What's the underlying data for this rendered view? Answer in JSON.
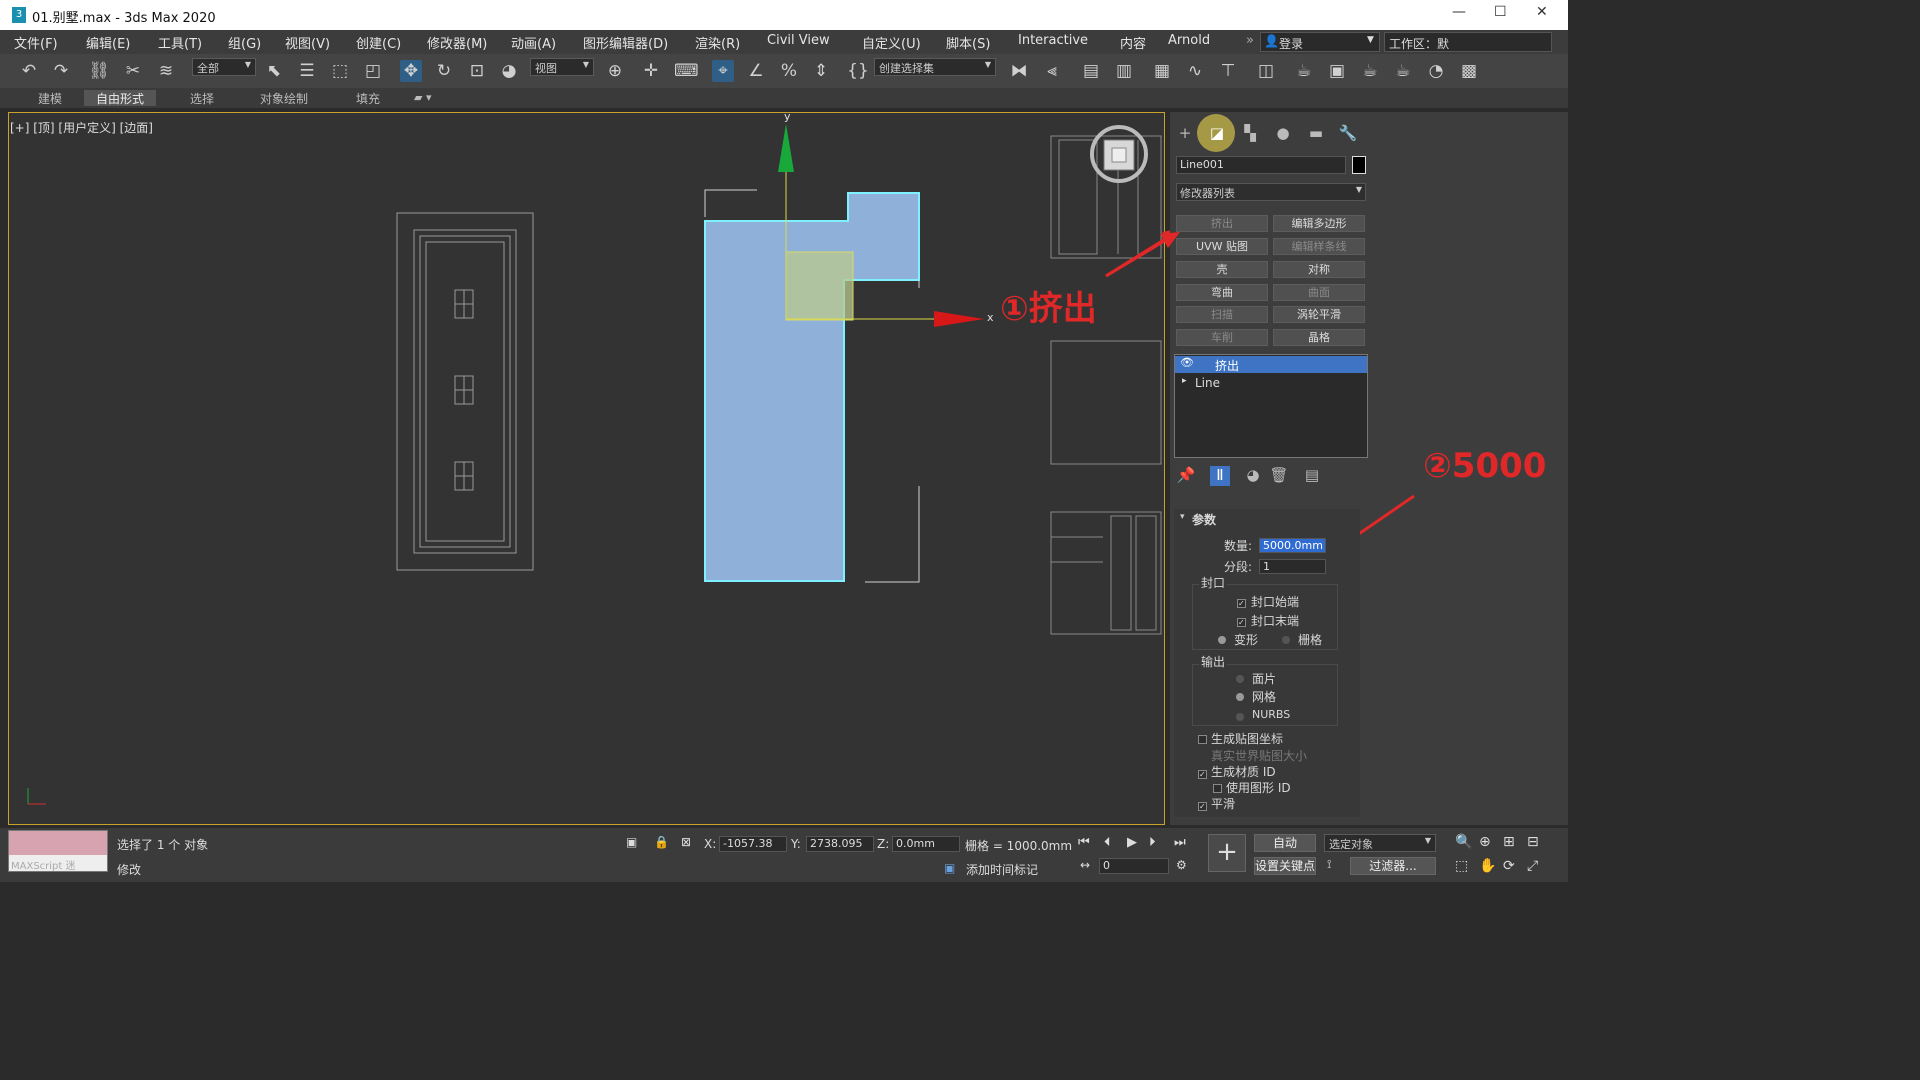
{
  "window": {
    "title": "01.别墅.max - 3ds Max 2020",
    "app_icon": "3"
  },
  "menu": [
    "文件(F)",
    "编辑(E)",
    "工具(T)",
    "组(G)",
    "视图(V)",
    "创建(C)",
    "修改器(M)",
    "动画(A)",
    "图形编辑器(D)",
    "渲染(R)",
    "Civil View",
    "自定义(U)",
    "脚本(S)",
    "Interactive",
    "内容",
    "Arnold"
  ],
  "login": "登录",
  "workspace_partial": "工作区：默",
  "toolbar": {
    "filter_select": "全部",
    "ref_coord": "视图",
    "named_selection": "创建选择集"
  },
  "ribbon_tabs": [
    "建模",
    "自由形式",
    "选择",
    "对象绘制",
    "填充"
  ],
  "ribbon_active": "自由形式",
  "viewport": {
    "label": "[+] [顶] [用户定义] [边面]",
    "axis_x": "x",
    "axis_y": "y",
    "annotation_1": "①挤出"
  },
  "command_panel": {
    "object_name": "Line001",
    "modifier_list": "修改器列表",
    "modifier_buttons": [
      {
        "label": "挤出",
        "enabled": false
      },
      {
        "label": "编辑多边形",
        "enabled": true
      },
      {
        "label": "UVW 贴图",
        "enabled": true
      },
      {
        "label": "编辑样条线",
        "enabled": false
      },
      {
        "label": "壳",
        "enabled": true
      },
      {
        "label": "对称",
        "enabled": true
      },
      {
        "label": "弯曲",
        "enabled": true
      },
      {
        "label": "曲面",
        "enabled": false
      },
      {
        "label": "扫描",
        "enabled": false
      },
      {
        "label": "涡轮平滑",
        "enabled": true
      },
      {
        "label": "车削",
        "enabled": false
      },
      {
        "label": "晶格",
        "enabled": true
      }
    ],
    "stack": [
      "挤出",
      "Line"
    ],
    "annotation_2": "②5000",
    "params": {
      "title": "参数",
      "amount_label": "数量:",
      "amount_value": "5000.0mm",
      "segments_label": "分段:",
      "segments_value": "1",
      "capping_title": "封口",
      "cap_start": "封口始端",
      "cap_end": "封口末端",
      "morph": "变形",
      "grid": "栅格",
      "output_title": "输出",
      "patch": "面片",
      "mesh": "网格",
      "nurbs": "NURBS",
      "gen_map": "生成贴图坐标",
      "real_world": "真实世界贴图大小",
      "gen_matid": "生成材质 ID",
      "use_shape_id": "使用图形 ID",
      "smooth": "平滑"
    }
  },
  "status": {
    "maxscript": "MAXScript 迷",
    "selected": "选择了 1 个 对象",
    "mode": "修改",
    "x_label": "X:",
    "x": "-1057.38",
    "y_label": "Y:",
    "y": "2738.095",
    "z_label": "Z:",
    "z": "0.0mm",
    "grid": "栅格 = 1000.0mm",
    "add_time_tag": "添加时间标记",
    "auto": "自动",
    "selected_obj": "选定对象",
    "set_key": "设置关键点",
    "filters": "过滤器...",
    "frame": "0"
  },
  "colors": {
    "accent": "#3f74c4",
    "annotation": "#e02828",
    "shape_fill": "#8fb1d9",
    "shape_edge": "#7ff0ff"
  }
}
